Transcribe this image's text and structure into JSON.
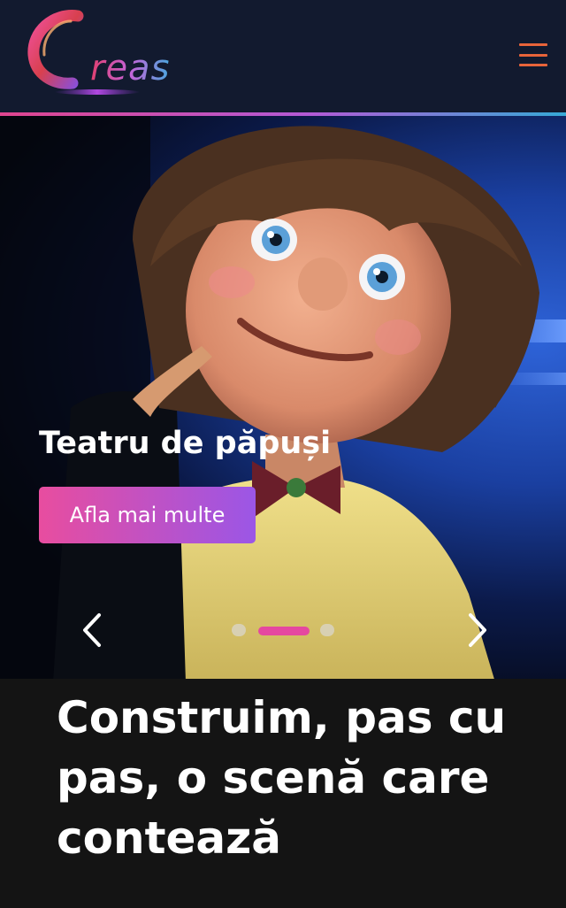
{
  "header": {
    "logo_text": "reas",
    "logo_icon": "creas-logo-icon",
    "menu_icon": "hamburger-icon",
    "accent_color": "#e8643a"
  },
  "hero": {
    "slide_title": "Teatru de păpuși",
    "cta_label": "Afla mai multe",
    "prev_icon": "chevron-left-icon",
    "next_icon": "chevron-right-icon",
    "slides_total": 3,
    "active_slide": 2
  },
  "section": {
    "headline": "Construim, pas cu pas, o scenă care contează"
  },
  "colors": {
    "header_bg": "#121a2f",
    "cta_gradient_start": "#e84d9f",
    "cta_gradient_end": "#9b56e6",
    "dot_active": "#e548a0",
    "page_bg": "#141414"
  }
}
